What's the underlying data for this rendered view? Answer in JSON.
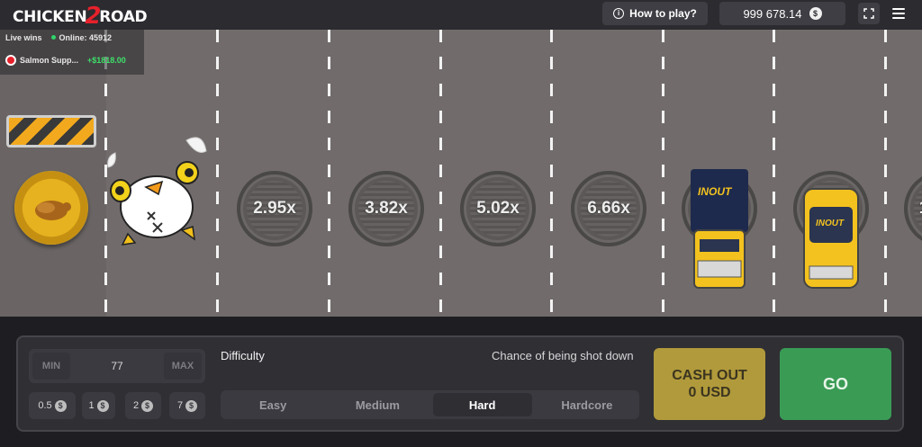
{
  "header": {
    "logo_part1": "CHICKEN",
    "logo_num": "2",
    "logo_part2": "ROAD",
    "how_to_play": "How to play?",
    "balance": "999 678.14",
    "currency_symbol": "$"
  },
  "live": {
    "label": "Live wins",
    "online": "Online: 45912",
    "entry_name": "Salmon Supp...",
    "entry_amount": "+$1818.00"
  },
  "lanes": {
    "multipliers": [
      "2.95x",
      "3.82x",
      "5.02x",
      "6.66x"
    ],
    "partial_multiplier": "1"
  },
  "trucks": {
    "brand": "INOUT"
  },
  "controls": {
    "bet_min": "MIN",
    "bet_value": "77",
    "bet_max": "MAX",
    "chips": [
      "0.5",
      "1",
      "2",
      "7"
    ],
    "difficulty_label": "Difficulty",
    "chance_label": "Chance of being shot down",
    "difficulties": [
      "Easy",
      "Medium",
      "Hard",
      "Hardcore"
    ],
    "selected_difficulty": "Hard",
    "cashout_line1": "CASH OUT",
    "cashout_line2": "0 USD",
    "go_label": "GO"
  },
  "colors": {
    "road": "#716c6b",
    "go_button": "#3a9b55",
    "cashout_button": "#b19a3b",
    "win_text": "#3ee06a",
    "logo_accent": "#e6212b"
  }
}
